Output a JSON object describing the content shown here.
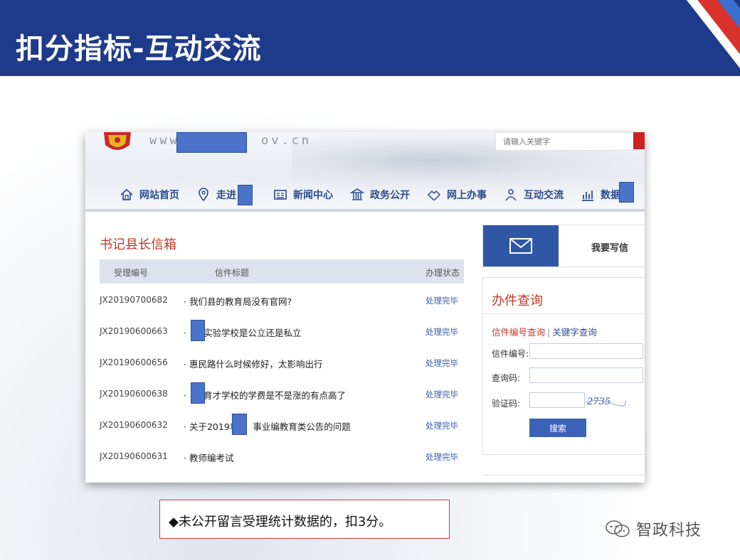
{
  "slide": {
    "title": "扣分指标-互动交流",
    "note": "◆未公开留言受理统计数据的，扣3分。",
    "watermark": "智政科技"
  },
  "site": {
    "url_prefix": "www.",
    "url_suffix": "ov.cn",
    "search_placeholder": "请输入关键字",
    "nav": [
      {
        "label": "网站首页",
        "icon": "home-icon"
      },
      {
        "label": "走进",
        "icon": "location-pin-icon"
      },
      {
        "label": "新闻中心",
        "icon": "newspaper-icon"
      },
      {
        "label": "政务公开",
        "icon": "government-building-icon"
      },
      {
        "label": "网上办事",
        "icon": "handshake-icon"
      },
      {
        "label": "互动交流",
        "icon": "people-icon"
      },
      {
        "label": "数据",
        "icon": "bar-chart-icon"
      }
    ]
  },
  "mailbox": {
    "title": "书记县长信箱",
    "headers": {
      "id": "受理编号",
      "title": "信件标题",
      "status": "办理状态"
    },
    "rows": [
      {
        "id": "JX20190700682",
        "title": "我们县的教育局没有官网?",
        "status": "处理完毕"
      },
      {
        "id": "JX20190600663",
        "title": "实验学校是公立还是私立",
        "status": "处理完毕"
      },
      {
        "id": "JX20190600656",
        "title": "惠民路什么时候修好，太影响出行",
        "status": "处理完毕"
      },
      {
        "id": "JX20190600638",
        "title": "育才学校的学费是不是涨的有点高了",
        "status": "处理完毕"
      },
      {
        "id": "JX20190600632",
        "title": "关于2019年",
        "title_suffix": "事业编教育类公告的问题",
        "status": "处理完毕"
      },
      {
        "id": "JX20190600631",
        "title": "教师编考试",
        "status": "处理完毕"
      }
    ],
    "bullet": "·"
  },
  "sidebar": {
    "write_label": "我要写信",
    "query": {
      "title": "办件查询",
      "tab_active": "信件编号查询",
      "tab_separator": "|",
      "tab_other": "关键字查询",
      "letter_no_label": "信件编号:",
      "query_code_label": "查询码:",
      "captcha_label": "验证码:",
      "captcha_text": "2735",
      "search_button": "搜索"
    }
  },
  "colors": {
    "banner": "#1e3a8a",
    "accent_red": "#c0392b",
    "nav_blue": "#2b4a8e",
    "redaction": "#4a73c9"
  }
}
